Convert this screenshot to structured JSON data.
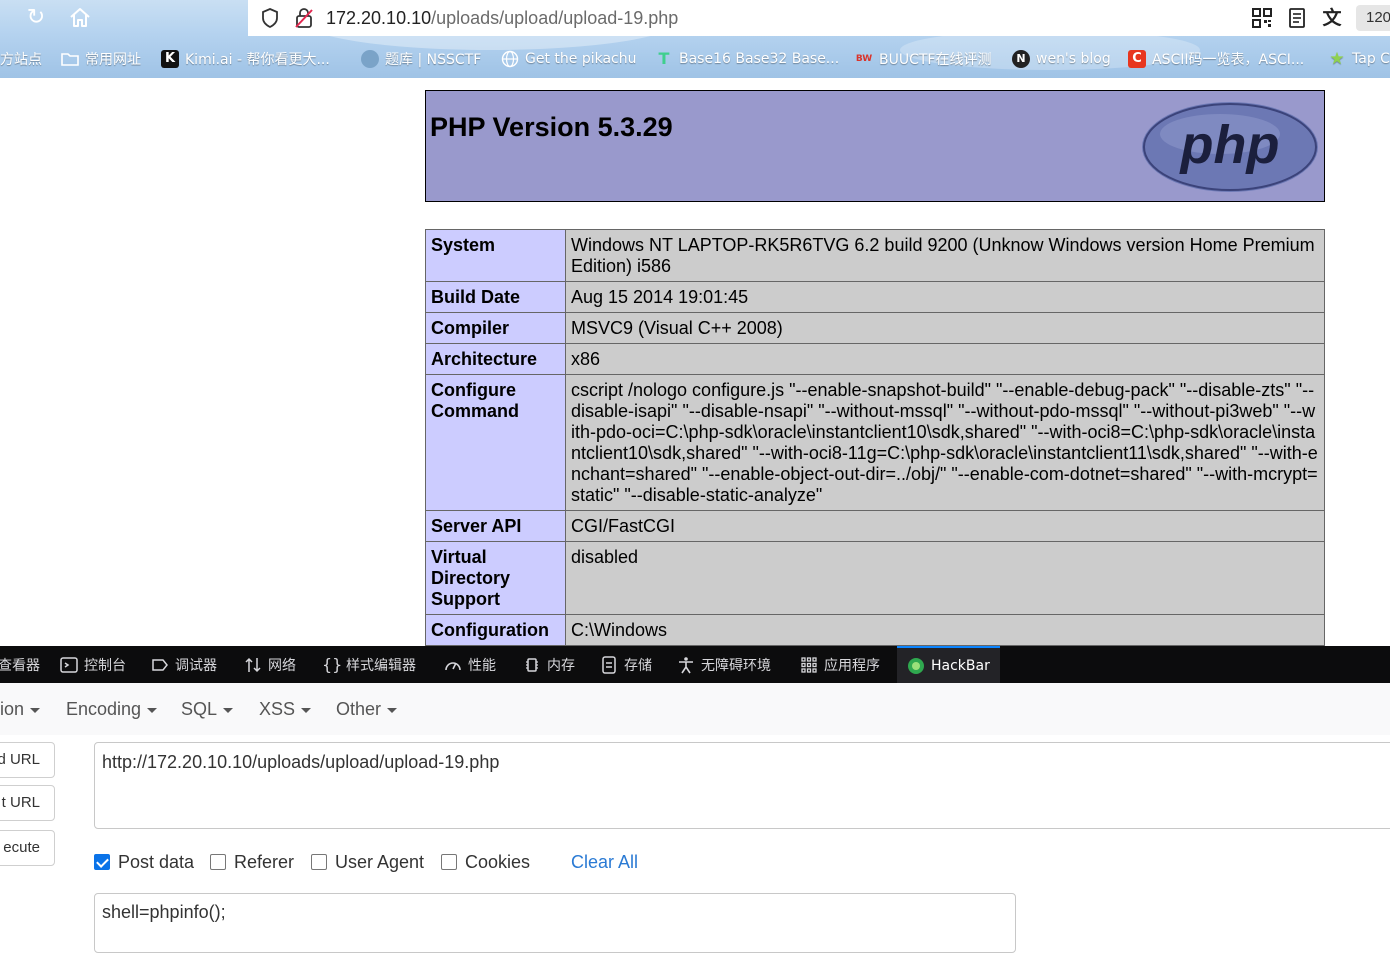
{
  "browser": {
    "url_host": "172.20.10.10",
    "url_path": "/uploads/upload/upload-19.php",
    "zoom": "120",
    "bookmarks": [
      {
        "label": "方站点",
        "icon": "none"
      },
      {
        "label": "常用网址",
        "icon": "folder-icon"
      },
      {
        "label": "Kimi.ai - 帮你看更大...",
        "icon": "kimi-icon"
      },
      {
        "label": "题库 | NSSCTF",
        "icon": "nssctf-icon"
      },
      {
        "label": "Get the pikachu",
        "icon": "globe-icon"
      },
      {
        "label": "Base16 Base32 Base...",
        "icon": "tool-icon"
      },
      {
        "label": "BUUCTF在线评测",
        "icon": "buuctf-icon"
      },
      {
        "label": "wen's blog",
        "icon": "notion-icon"
      },
      {
        "label": "ASCII码一览表，ASCI...",
        "icon": "csdn-icon"
      },
      {
        "label": "Tap C",
        "icon": "star-icon"
      }
    ]
  },
  "phpinfo": {
    "title": "PHP Version 5.3.29",
    "logo_text": "php",
    "rows": [
      {
        "key": "System",
        "value": "Windows NT LAPTOP-RK5R6TVG 6.2 build 9200 (Unknow Windows version Home Premium Edition) i586"
      },
      {
        "key": "Build Date",
        "value": "Aug 15 2014 19:01:45"
      },
      {
        "key": "Compiler",
        "value": "MSVC9 (Visual C++ 2008)"
      },
      {
        "key": "Architecture",
        "value": "x86"
      },
      {
        "key": "Configure Command",
        "value": "cscript /nologo configure.js \"--enable-snapshot-build\" \"--enable-debug-pack\" \"--disable-zts\" \"--disable-isapi\" \"--disable-nsapi\" \"--without-mssql\" \"--without-pdo-mssql\" \"--without-pi3web\" \"--with-pdo-oci=C:\\php-sdk\\oracle\\instantclient10\\sdk,shared\" \"--with-oci8=C:\\php-sdk\\oracle\\instantclient10\\sdk,shared\" \"--with-oci8-11g=C:\\php-sdk\\oracle\\instantclient11\\sdk,shared\" \"--with-enchant=shared\" \"--enable-object-out-dir=../obj/\" \"--enable-com-dotnet=shared\" \"--with-mcrypt=static\" \"--disable-static-analyze\""
      },
      {
        "key": "Server API",
        "value": "CGI/FastCGI"
      },
      {
        "key": "Virtual Directory Support",
        "value": "disabled"
      },
      {
        "key": "Configuration",
        "value": "C:\\Windows"
      }
    ]
  },
  "devtools": {
    "tabs": [
      {
        "label": "查看器",
        "icon": "inspector-icon"
      },
      {
        "label": "控制台",
        "icon": "console-icon"
      },
      {
        "label": "调试器",
        "icon": "debugger-icon"
      },
      {
        "label": "网络",
        "icon": "network-icon"
      },
      {
        "label": "样式编辑器",
        "icon": "style-editor-icon"
      },
      {
        "label": "性能",
        "icon": "performance-icon"
      },
      {
        "label": "内存",
        "icon": "memory-icon"
      },
      {
        "label": "存储",
        "icon": "storage-icon"
      },
      {
        "label": "无障碍环境",
        "icon": "accessibility-icon"
      },
      {
        "label": "应用程序",
        "icon": "application-icon"
      },
      {
        "label": "HackBar",
        "icon": "hackbar-icon"
      }
    ]
  },
  "hackbar": {
    "menus": [
      "ion",
      "Encoding",
      "SQL",
      "XSS",
      "Other"
    ],
    "side_buttons": [
      "d URL",
      "t URL",
      "ecute"
    ],
    "url_value": "http://172.20.10.10/uploads/upload/upload-19.php",
    "options": [
      {
        "label": "Post data",
        "checked": true
      },
      {
        "label": "Referer",
        "checked": false
      },
      {
        "label": "User Agent",
        "checked": false
      },
      {
        "label": "Cookies",
        "checked": false
      }
    ],
    "clear_all": "Clear All",
    "post_value": "shell=phpinfo();"
  },
  "colors": {
    "php_header": "#9999cc",
    "php_key": "#ccccff",
    "php_value": "#cccccc",
    "devtools_bg": "#0c0c0d",
    "link": "#2a7ad4",
    "checkbox": "#0a73e8"
  }
}
